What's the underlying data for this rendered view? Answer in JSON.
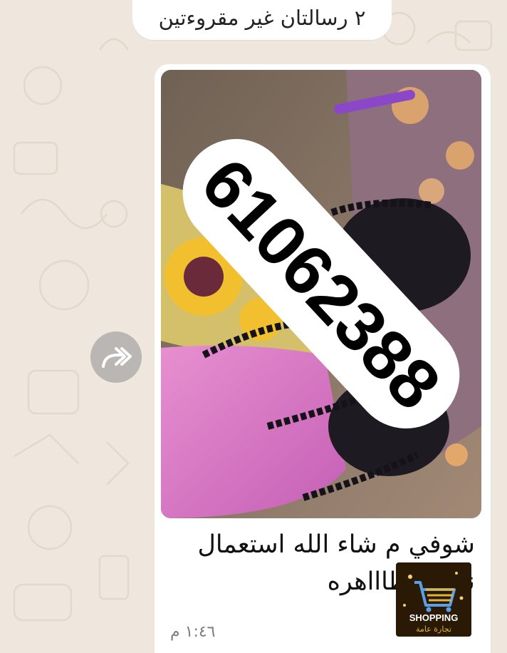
{
  "unread_banner": {
    "text": "٢ رسالتان غير مقروءتين"
  },
  "message": {
    "image": {
      "overlay_number": "61062388",
      "description_icon": "photo-thumbnail"
    },
    "caption": "شوفي م شاء الله استعمال\nنعومه ظاااهره",
    "timestamp": "١:٤٦ م",
    "sticker": {
      "title": "SHOPPING",
      "subtitle": "تجارة عامة"
    }
  },
  "forward_button": {
    "icon": "forward-icon"
  },
  "colors": {
    "chat_background": "#efe7dd",
    "bubble": "#ffffff",
    "forward_button": "#b9b6b3",
    "sticker_bg": "#2a1a05",
    "sticker_gold": "#e0b63a"
  }
}
